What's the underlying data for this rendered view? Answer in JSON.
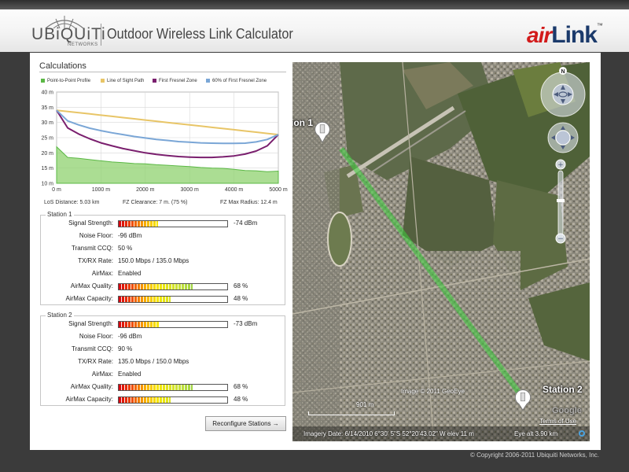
{
  "header": {
    "brand": "UBiQUiTi",
    "brand_sub": "NETWORKS",
    "title": "Outdoor Wireless Link Calculator",
    "airlink_air": "air",
    "airlink_link": "Link",
    "airlink_tm": "™"
  },
  "calculations": {
    "title": "Calculations",
    "legend": [
      {
        "label": "Point-to-Point Profile",
        "color": "#5bb845"
      },
      {
        "label": "Line of Sight Path",
        "color": "#e8c567"
      },
      {
        "label": "First Fresnel Zone",
        "color": "#7a1f6e"
      },
      {
        "label": "60% of First Fresnel Zone",
        "color": "#7aa6d6"
      }
    ],
    "stats": {
      "los_distance": "LoS Distance: 5.03 km",
      "fz_clearance": "FZ Clearance: 7 m. (75 %)",
      "fz_max_radius": "FZ Max Radius: 12.4 m"
    }
  },
  "chart_data": {
    "type": "line",
    "xlim": [
      0,
      5000
    ],
    "ylim": [
      10,
      40
    ],
    "x_ticks": [
      "0 m",
      "1000 m",
      "2000 m",
      "3000 m",
      "4000 m",
      "5000 m"
    ],
    "y_ticks": [
      "40 m",
      "35 m",
      "30 m",
      "25 m",
      "20 m",
      "15 m",
      "10 m"
    ],
    "grid": true,
    "x": [
      0,
      250,
      500,
      750,
      1000,
      1250,
      1500,
      1750,
      2000,
      2250,
      2500,
      2750,
      3000,
      3250,
      3500,
      3750,
      4000,
      4250,
      4500,
      4750,
      5000
    ],
    "series": [
      {
        "name": "Point-to-Point Profile",
        "color": "#5bb845",
        "values": [
          22,
          18.5,
          18.2,
          17.8,
          17.4,
          17,
          16.8,
          16.5,
          16.4,
          16.1,
          15.9,
          15.7,
          15.5,
          15.2,
          15,
          14.9,
          14.6,
          14.2,
          14.1,
          13.8,
          14
        ]
      },
      {
        "name": "Line of Sight Path",
        "color": "#e8c567",
        "values": [
          34,
          33.6,
          33.2,
          32.8,
          32.4,
          32,
          31.6,
          31.2,
          30.8,
          30.4,
          30,
          29.6,
          29.2,
          28.8,
          28.4,
          28,
          27.6,
          27.2,
          26.8,
          26.4,
          26
        ]
      },
      {
        "name": "First Fresnel Zone",
        "color": "#7a1f6e",
        "values": [
          34,
          28.2,
          26.2,
          24.6,
          23.3,
          22.3,
          21.4,
          20.7,
          20,
          19.5,
          19.1,
          18.8,
          18.6,
          18.5,
          18.5,
          18.7,
          19,
          19.6,
          20.6,
          22.3,
          26
        ]
      },
      {
        "name": "60% of First Fresnel Zone",
        "color": "#7aa6d6",
        "values": [
          34,
          30.5,
          29.2,
          28.1,
          27.3,
          26.6,
          26,
          25.4,
          24.9,
          24.4,
          24.1,
          23.7,
          23.5,
          23.3,
          23.2,
          23.1,
          23.1,
          23.2,
          23.6,
          24.4,
          26
        ]
      }
    ]
  },
  "station1": {
    "title": "Station 1",
    "signal_strength_label": "Signal Strength:",
    "signal_strength_value": "-74 dBm",
    "signal_strength_fill": 0.36,
    "noise_floor_label": "Noise Floor:",
    "noise_floor_value": "-96 dBm",
    "transmit_ccq_label": "Transmit CCQ:",
    "transmit_ccq_value": "50 %",
    "txrx_rate_label": "TX/RX Rate:",
    "txrx_rate_value": "150.0 Mbps / 135.0 Mbps",
    "airmax_label": "AirMax:",
    "airmax_value": "Enabled",
    "airmax_quality_label": "AirMax Quality:",
    "airmax_quality_value": "68 %",
    "airmax_quality_fill": 0.68,
    "airmax_capacity_label": "AirMax Capacity:",
    "airmax_capacity_value": "48 %",
    "airmax_capacity_fill": 0.48
  },
  "station2": {
    "title": "Station 2",
    "signal_strength_label": "Signal Strength:",
    "signal_strength_value": "-73 dBm",
    "signal_strength_fill": 0.38,
    "noise_floor_label": "Noise Floor:",
    "noise_floor_value": "-96 dBm",
    "transmit_ccq_label": "Transmit CCQ:",
    "transmit_ccq_value": "90 %",
    "txrx_rate_label": "TX/RX Rate:",
    "txrx_rate_value": "135.0 Mbps / 150.0 Mbps",
    "airmax_label": "AirMax:",
    "airmax_value": "Enabled",
    "airmax_quality_label": "AirMax Quality:",
    "airmax_quality_value": "68 %",
    "airmax_quality_fill": 0.68,
    "airmax_capacity_label": "AirMax Capacity:",
    "airmax_capacity_value": "48 %",
    "airmax_capacity_fill": 0.48
  },
  "reconfigure_label": "Reconfigure Stations →",
  "map": {
    "station1_label": "ion 1",
    "station2_label": "Station 2",
    "copyright": "Image © 2011 GeoEye",
    "scale": "901 m",
    "imagery_info": "Imagery Date: 6/14/2010 6°30' 5\"S 52°20'43.02\" W  elev  11 m",
    "eye_alt": "Eye alt   3.90 km",
    "terms": "Terms of Use",
    "google": "Google",
    "compass_n": "N"
  },
  "footer": "© Copyright 2006-2011 Ubiquiti Networks, Inc."
}
